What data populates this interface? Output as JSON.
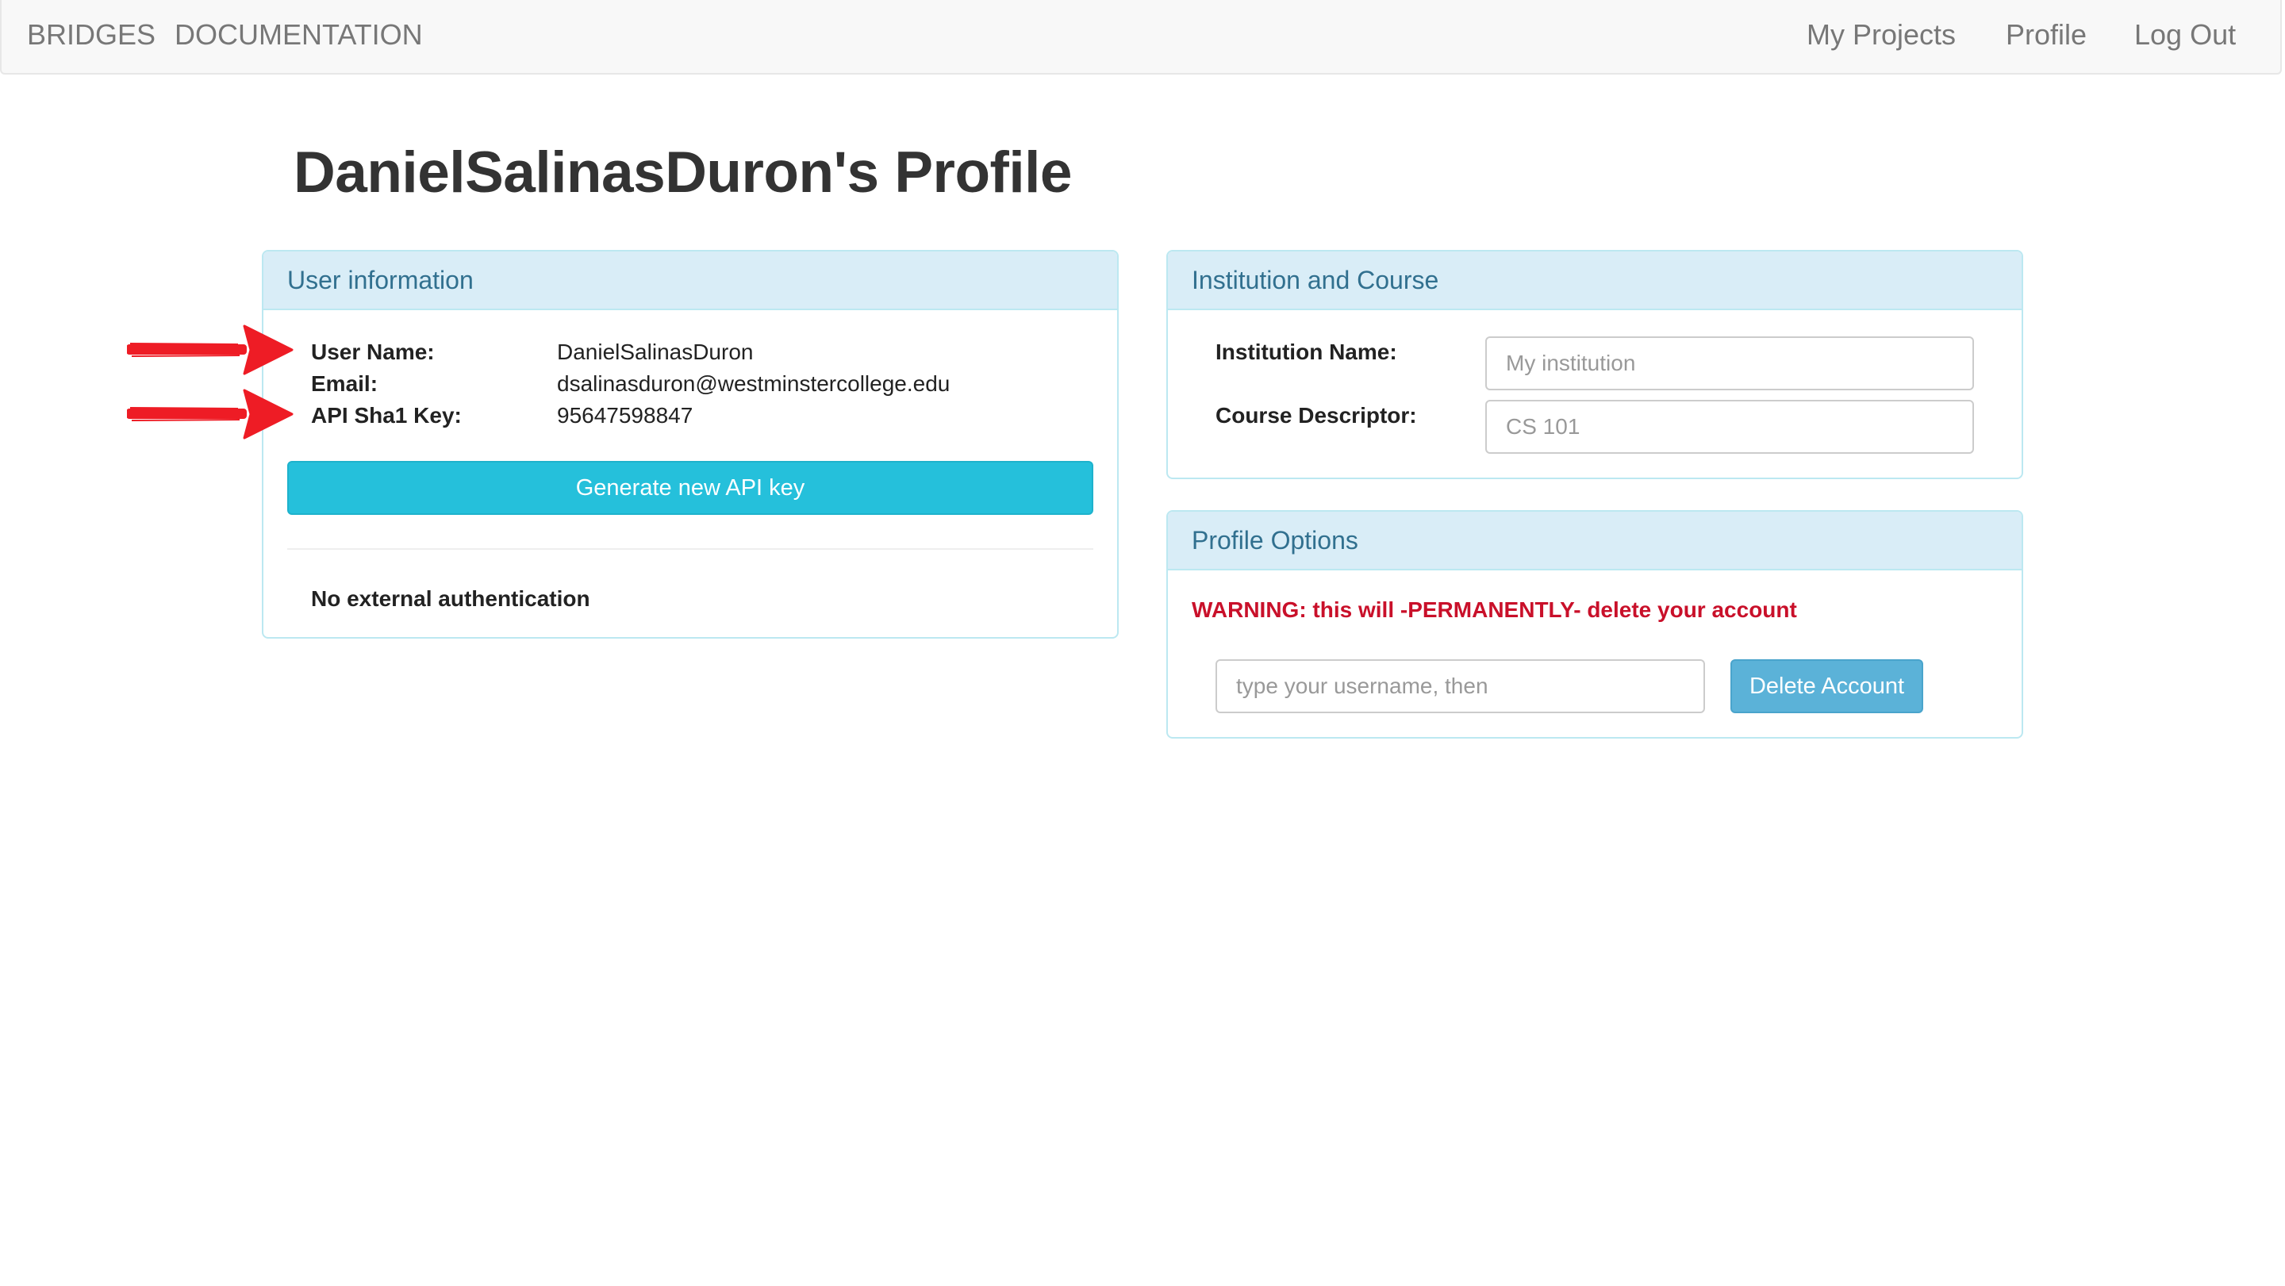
{
  "navbar": {
    "brand": "BRIDGES",
    "documentation": "DOCUMENTATION",
    "my_projects": "My Projects",
    "profile": "Profile",
    "logout": "Log Out"
  },
  "page_title": "DanielSalinasDuron's Profile",
  "user_info": {
    "heading": "User information",
    "username_label": "User Name:",
    "username_value": "DanielSalinasDuron",
    "email_label": "Email:",
    "email_value": "dsalinasduron@westminstercollege.edu",
    "api_key_label": "API Sha1 Key:",
    "api_key_value": "95647598847",
    "generate_button": "Generate new API key",
    "external_auth": "No external authentication"
  },
  "institution": {
    "heading": "Institution and Course",
    "institution_label": "Institution Name:",
    "institution_placeholder": "My institution",
    "course_label": "Course Descriptor:",
    "course_placeholder": "CS 101"
  },
  "profile_options": {
    "heading": "Profile Options",
    "warning": "WARNING: this will -PERMANENTLY- delete your account",
    "confirm_placeholder": "type your username, then",
    "delete_button": "Delete Account"
  },
  "annotations": {
    "arrow_color": "#ee1c25"
  },
  "colors": {
    "panel_heading_bg": "#d9edf7",
    "panel_border": "#bce8f1",
    "panel_title": "#31708f",
    "generate_button_bg": "#25c0db",
    "delete_button_bg": "#5bb2d8",
    "warning": "#c9102a"
  }
}
